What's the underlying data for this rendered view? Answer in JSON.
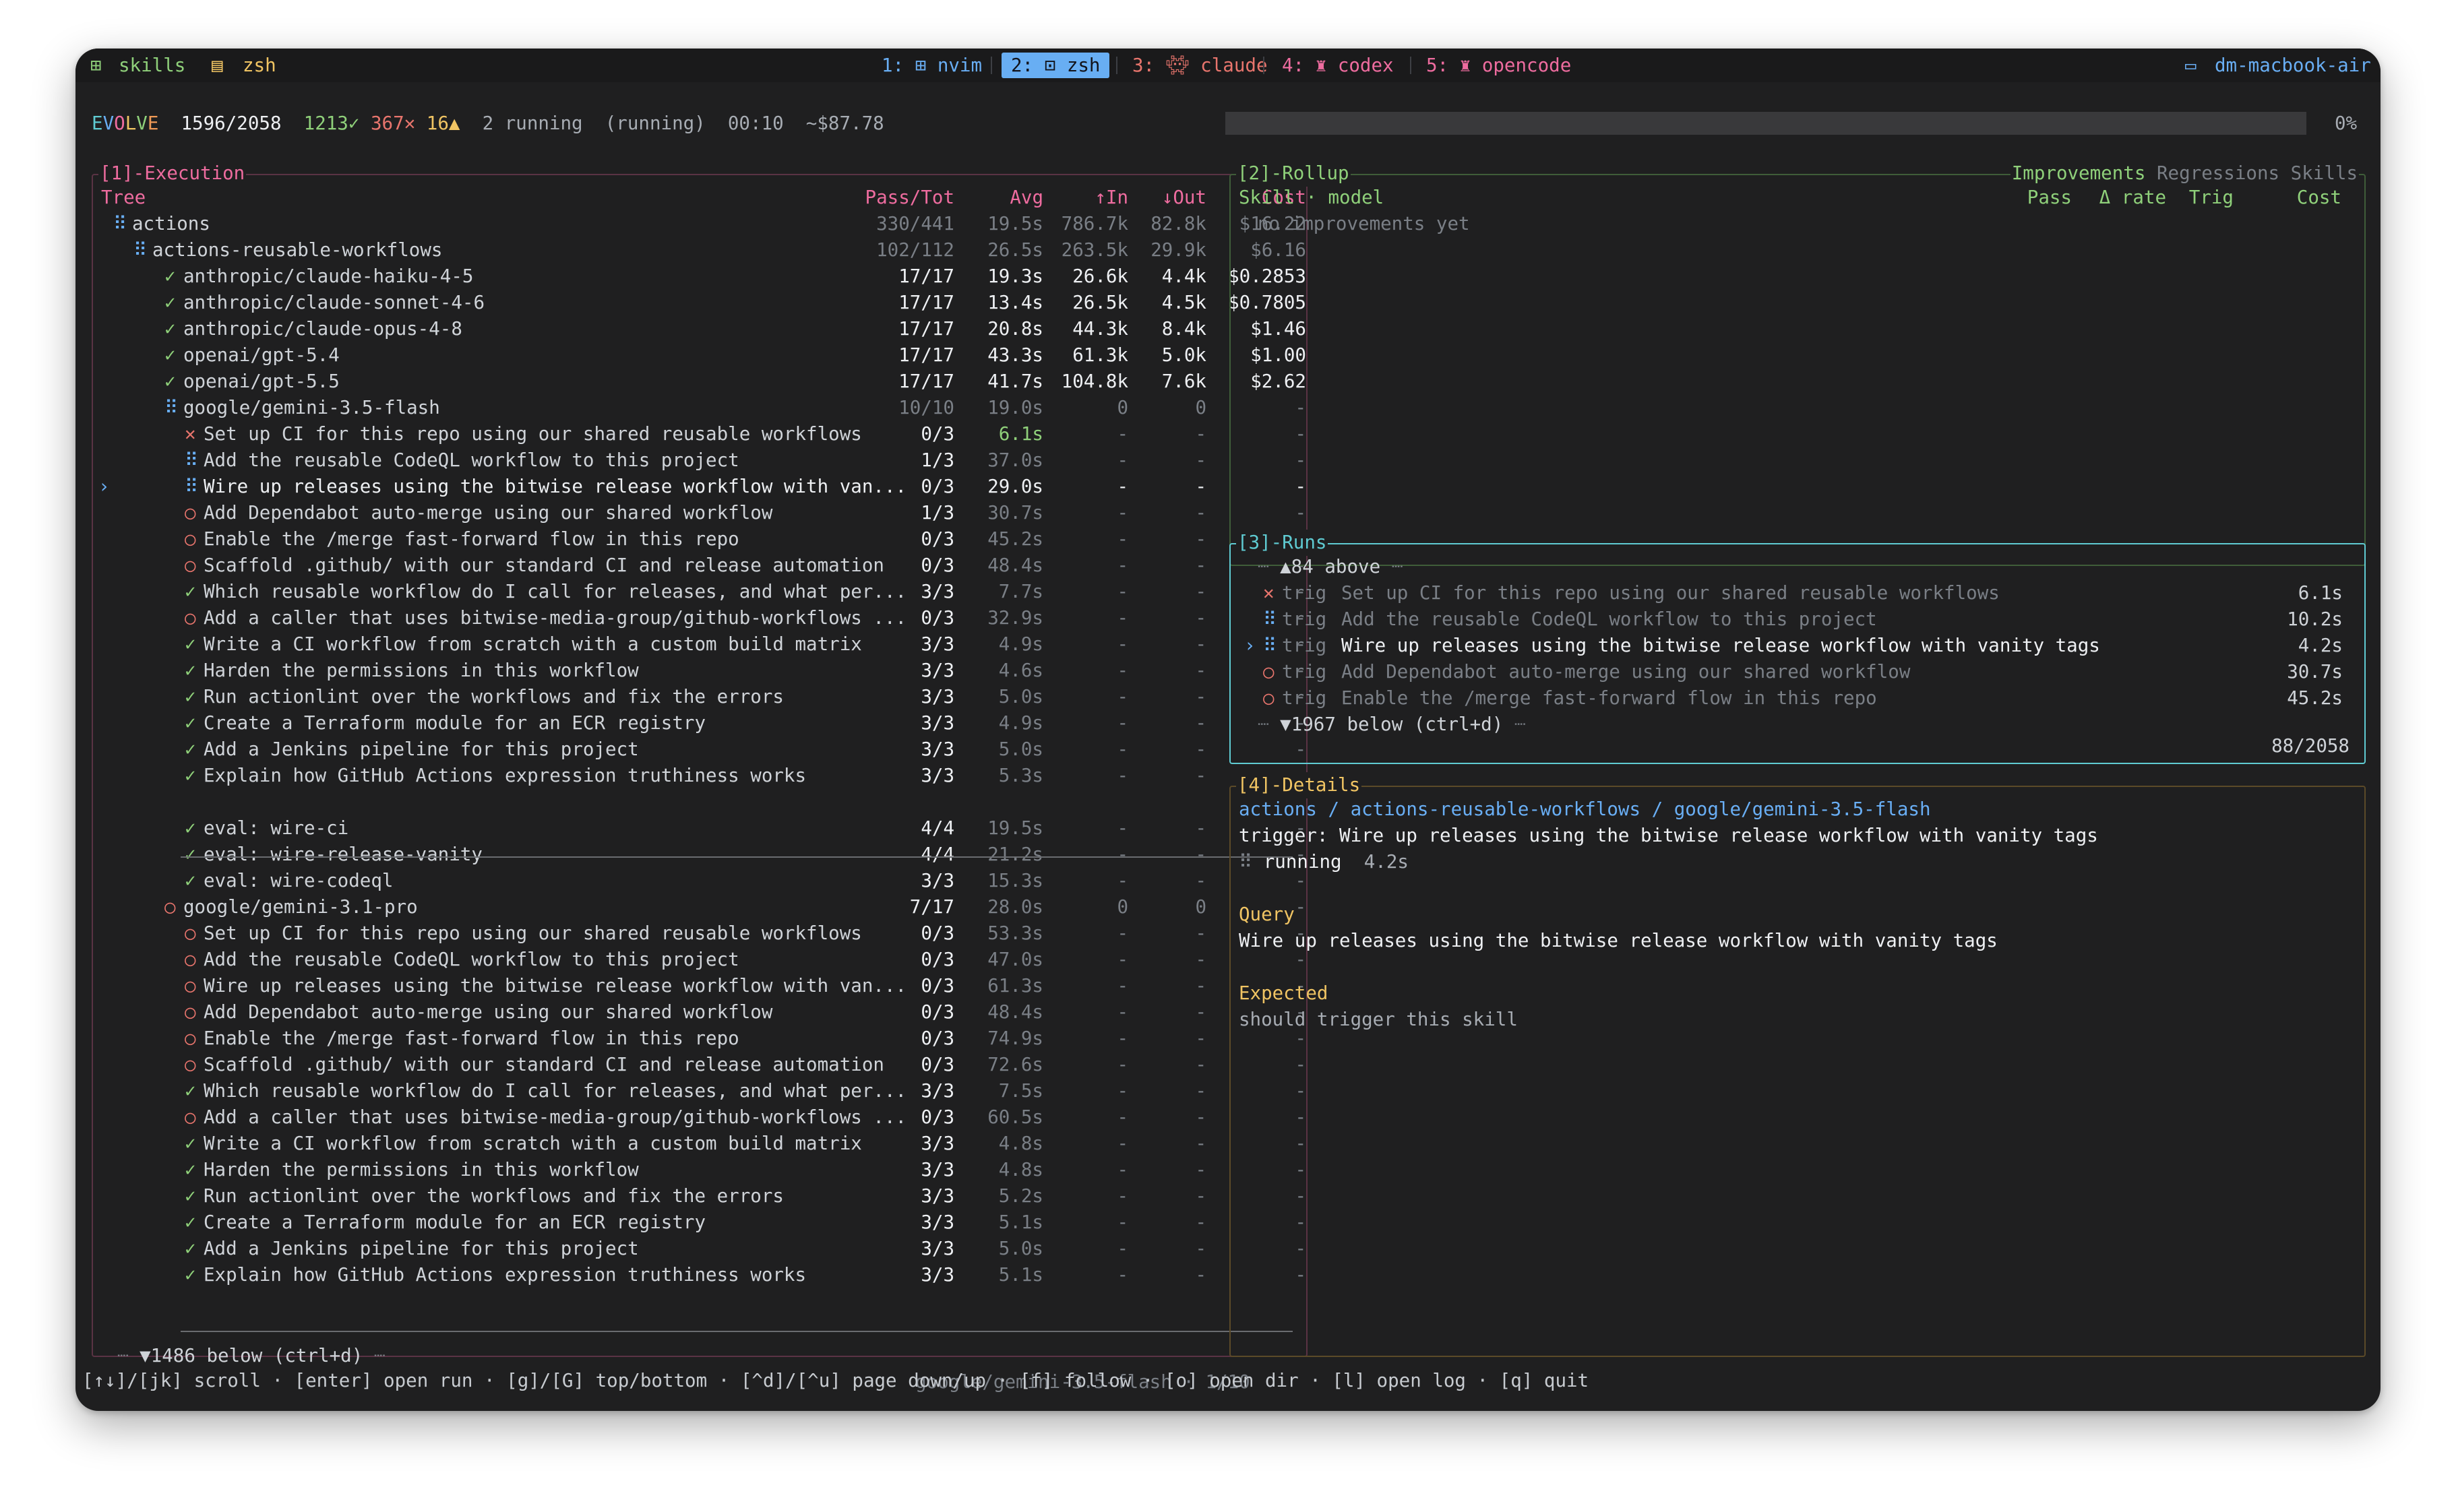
{
  "tmux": {
    "session": "skills",
    "left_window": "zsh",
    "windows": [
      {
        "num": "1:",
        "name": "nvim"
      },
      {
        "num": "2:",
        "name": "zsh"
      },
      {
        "num": "3:",
        "name": "claude"
      },
      {
        "num": "4:",
        "name": "codex"
      },
      {
        "num": "5:",
        "name": "opencode"
      }
    ],
    "host": "dm-macbook-air"
  },
  "header": {
    "app_e": "E",
    "app_v": "V",
    "app_o": "O",
    "app_l": "L",
    "app_v2": "V",
    "app_e2": "E",
    "progress_count": "1596/2058",
    "pass_count": "1213✓",
    "fail_count": "367✕",
    "warn_count": "16▲",
    "running": "2 running",
    "state": "(running)",
    "elapsed": "00:10",
    "cost": "~$87.78",
    "percent": "0%"
  },
  "execution": {
    "title": "[1]-Execution",
    "columns": {
      "tree": "Tree",
      "pass": "Pass/Tot",
      "avg": "Avg",
      "in": "↑In",
      "out": "↓Out",
      "cost": "Cost"
    },
    "rows": [
      {
        "icon": "⠿",
        "label": "actions",
        "pass": "330/441",
        "avg": "19.5s",
        "in": "786.7k",
        "out": "82.8k",
        "cost": "$16.22"
      },
      {
        "icon": "⠿",
        "label": "actions-reusable-workflows",
        "pass": "102/112",
        "avg": "26.5s",
        "in": "263.5k",
        "out": "29.9k",
        "cost": "$6.16"
      },
      {
        "icon": "✓",
        "label": "anthropic/claude-haiku-4-5",
        "pass": "17/17",
        "avg": "19.3s",
        "in": "26.6k",
        "out": "4.4k",
        "cost": "$0.2853"
      },
      {
        "icon": "✓",
        "label": "anthropic/claude-sonnet-4-6",
        "pass": "17/17",
        "avg": "13.4s",
        "in": "26.5k",
        "out": "4.5k",
        "cost": "$0.7805"
      },
      {
        "icon": "✓",
        "label": "anthropic/claude-opus-4-8",
        "pass": "17/17",
        "avg": "20.8s",
        "in": "44.3k",
        "out": "8.4k",
        "cost": "$1.46"
      },
      {
        "icon": "✓",
        "label": "openai/gpt-5.4",
        "pass": "17/17",
        "avg": "43.3s",
        "in": "61.3k",
        "out": "5.0k",
        "cost": "$1.00"
      },
      {
        "icon": "✓",
        "label": "openai/gpt-5.5",
        "pass": "17/17",
        "avg": "41.7s",
        "in": "104.8k",
        "out": "7.6k",
        "cost": "$2.62"
      },
      {
        "icon": "⠿",
        "label": "google/gemini-3.5-flash",
        "pass": "10/10",
        "avg": "19.0s",
        "in": "0",
        "out": "0",
        "cost": "-"
      },
      {
        "icon": "✕",
        "label": "Set up CI for this repo using our shared reusable workflows",
        "pass": "0/3",
        "avg": "6.1s",
        "in": "-",
        "out": "-",
        "cost": "-"
      },
      {
        "icon": "⠿",
        "label": "Add the reusable CodeQL workflow to this project",
        "pass": "1/3",
        "avg": "37.0s",
        "in": "-",
        "out": "-",
        "cost": "-"
      },
      {
        "icon": "⠿",
        "label": "Wire up releases using the bitwise release workflow with van...",
        "pass": "0/3",
        "avg": "29.0s",
        "in": "-",
        "out": "-",
        "cost": "-"
      },
      {
        "icon": "○",
        "label": "Add Dependabot auto-merge using our shared workflow",
        "pass": "1/3",
        "avg": "30.7s",
        "in": "-",
        "out": "-",
        "cost": "-"
      },
      {
        "icon": "○",
        "label": "Enable the /merge fast-forward flow in this repo",
        "pass": "0/3",
        "avg": "45.2s",
        "in": "-",
        "out": "-",
        "cost": "-"
      },
      {
        "icon": "○",
        "label": "Scaffold .github/ with our standard CI and release automation",
        "pass": "0/3",
        "avg": "48.4s",
        "in": "-",
        "out": "-",
        "cost": "-"
      },
      {
        "icon": "✓",
        "label": "Which reusable workflow do I call for releases, and what per...",
        "pass": "3/3",
        "avg": "7.7s",
        "in": "-",
        "out": "-",
        "cost": "-"
      },
      {
        "icon": "○",
        "label": "Add a caller that uses bitwise-media-group/github-workflows ...",
        "pass": "0/3",
        "avg": "32.9s",
        "in": "-",
        "out": "-",
        "cost": "-"
      },
      {
        "icon": "✓",
        "label": "Write a CI workflow from scratch with a custom build matrix",
        "pass": "3/3",
        "avg": "4.9s",
        "in": "-",
        "out": "-",
        "cost": "-"
      },
      {
        "icon": "✓",
        "label": "Harden the permissions in this workflow",
        "pass": "3/3",
        "avg": "4.6s",
        "in": "-",
        "out": "-",
        "cost": "-"
      },
      {
        "icon": "✓",
        "label": "Run actionlint over the workflows and fix the errors",
        "pass": "3/3",
        "avg": "5.0s",
        "in": "-",
        "out": "-",
        "cost": "-"
      },
      {
        "icon": "✓",
        "label": "Create a Terraform module for an ECR registry",
        "pass": "3/3",
        "avg": "4.9s",
        "in": "-",
        "out": "-",
        "cost": "-"
      },
      {
        "icon": "✓",
        "label": "Add a Jenkins pipeline for this project",
        "pass": "3/3",
        "avg": "5.0s",
        "in": "-",
        "out": "-",
        "cost": "-"
      },
      {
        "icon": "✓",
        "label": "Explain how GitHub Actions expression truthiness works",
        "pass": "3/3",
        "avg": "5.3s",
        "in": "-",
        "out": "-",
        "cost": "-"
      },
      {
        "icon": "✓",
        "label": "eval: wire-ci",
        "pass": "4/4",
        "avg": "19.5s",
        "in": "-",
        "out": "-",
        "cost": "-"
      },
      {
        "icon": "✓",
        "label": "eval: wire-release-vanity",
        "pass": "4/4",
        "avg": "21.2s",
        "in": "-",
        "out": "-",
        "cost": "-"
      },
      {
        "icon": "✓",
        "label": "eval: wire-codeql",
        "pass": "3/3",
        "avg": "15.3s",
        "in": "-",
        "out": "-",
        "cost": "-"
      },
      {
        "icon": "○",
        "label": "google/gemini-3.1-pro",
        "pass": "7/17",
        "avg": "28.0s",
        "in": "0",
        "out": "0",
        "cost": "-"
      },
      {
        "icon": "○",
        "label": "Set up CI for this repo using our shared reusable workflows",
        "pass": "0/3",
        "avg": "53.3s",
        "in": "-",
        "out": "-",
        "cost": "-"
      },
      {
        "icon": "○",
        "label": "Add the reusable CodeQL workflow to this project",
        "pass": "0/3",
        "avg": "47.0s",
        "in": "-",
        "out": "-",
        "cost": "-"
      },
      {
        "icon": "○",
        "label": "Wire up releases using the bitwise release workflow with van...",
        "pass": "0/3",
        "avg": "61.3s",
        "in": "-",
        "out": "-",
        "cost": "-"
      },
      {
        "icon": "○",
        "label": "Add Dependabot auto-merge using our shared workflow",
        "pass": "0/3",
        "avg": "48.4s",
        "in": "-",
        "out": "-",
        "cost": "-"
      },
      {
        "icon": "○",
        "label": "Enable the /merge fast-forward flow in this repo",
        "pass": "0/3",
        "avg": "74.9s",
        "in": "-",
        "out": "-",
        "cost": "-"
      },
      {
        "icon": "○",
        "label": "Scaffold .github/ with our standard CI and release automation",
        "pass": "0/3",
        "avg": "72.6s",
        "in": "-",
        "out": "-",
        "cost": "-"
      },
      {
        "icon": "✓",
        "label": "Which reusable workflow do I call for releases, and what per...",
        "pass": "3/3",
        "avg": "7.5s",
        "in": "-",
        "out": "-",
        "cost": "-"
      },
      {
        "icon": "○",
        "label": "Add a caller that uses bitwise-media-group/github-workflows ...",
        "pass": "0/3",
        "avg": "60.5s",
        "in": "-",
        "out": "-",
        "cost": "-"
      },
      {
        "icon": "✓",
        "label": "Write a CI workflow from scratch with a custom build matrix",
        "pass": "3/3",
        "avg": "4.8s",
        "in": "-",
        "out": "-",
        "cost": "-"
      },
      {
        "icon": "✓",
        "label": "Harden the permissions in this workflow",
        "pass": "3/3",
        "avg": "4.8s",
        "in": "-",
        "out": "-",
        "cost": "-"
      },
      {
        "icon": "✓",
        "label": "Run actionlint over the workflows and fix the errors",
        "pass": "3/3",
        "avg": "5.2s",
        "in": "-",
        "out": "-",
        "cost": "-"
      },
      {
        "icon": "✓",
        "label": "Create a Terraform module for an ECR registry",
        "pass": "3/3",
        "avg": "5.1s",
        "in": "-",
        "out": "-",
        "cost": "-"
      },
      {
        "icon": "✓",
        "label": "Add a Jenkins pipeline for this project",
        "pass": "3/3",
        "avg": "5.0s",
        "in": "-",
        "out": "-",
        "cost": "-"
      },
      {
        "icon": "✓",
        "label": "Explain how GitHub Actions expression truthiness works",
        "pass": "3/3",
        "avg": "5.1s",
        "in": "-",
        "out": "-",
        "cost": "-"
      }
    ],
    "selected_marker": "›",
    "below": "▼1486 below (ctrl+d)",
    "footer": "google/gemini-3.5-flash · 1/10"
  },
  "rollup": {
    "title": "[2]-Rollup",
    "tabs": [
      "Improvements",
      "Regressions",
      "Skills"
    ],
    "columns": {
      "skill": "Skill · model",
      "pass": "Pass",
      "rate": "Δ rate",
      "trig": "Trig",
      "cost": "Cost"
    },
    "empty": "no improvements yet"
  },
  "runs": {
    "title": "[3]-Runs",
    "above": "▲84 above",
    "items": [
      {
        "icon": "✕",
        "kind": "trig",
        "text": "Set up CI for this repo using our shared reusable workflows",
        "time": "6.1s"
      },
      {
        "icon": "⠿",
        "kind": "trig",
        "text": "Add the reusable CodeQL workflow to this project",
        "time": "10.2s"
      },
      {
        "icon": "⠿",
        "kind": "trig",
        "text": "Wire up releases using the bitwise release workflow with vanity tags",
        "time": "4.2s"
      },
      {
        "icon": "○",
        "kind": "trig",
        "text": "Add Dependabot auto-merge using our shared workflow",
        "time": "30.7s"
      },
      {
        "icon": "○",
        "kind": "trig",
        "text": "Enable the /merge fast-forward flow in this repo",
        "time": "45.2s"
      }
    ],
    "selected_marker": "›",
    "below": "▼1967 below (ctrl+d)",
    "counter": "88/2058"
  },
  "details": {
    "title": "[4]-Details",
    "path": "actions / actions-reusable-workflows / google/gemini-3.5-flash",
    "trigger": "trigger: Wire up releases using the bitwise release workflow with vanity tags",
    "status_icon": "⠿",
    "status": "running",
    "status_time": "4.2s",
    "query_heading": "Query",
    "query": "Wire up releases using the bitwise release workflow with vanity tags",
    "expected_heading": "Expected",
    "expected": "should trigger this skill"
  },
  "help": "[↑↓]/[jk] scroll · [enter] open run · [g]/[G] top/bottom · [^d]/[^u] page down/up · [f] follow · [o] open dir · [l] open log · [q] quit",
  "colors": {
    "pass": "#8fd07a",
    "fail": "#e8756d",
    "pink": "#ee6c9f",
    "blue": "#69aef4",
    "cyan": "#5fcbd2",
    "yellow": "#f0c463"
  }
}
